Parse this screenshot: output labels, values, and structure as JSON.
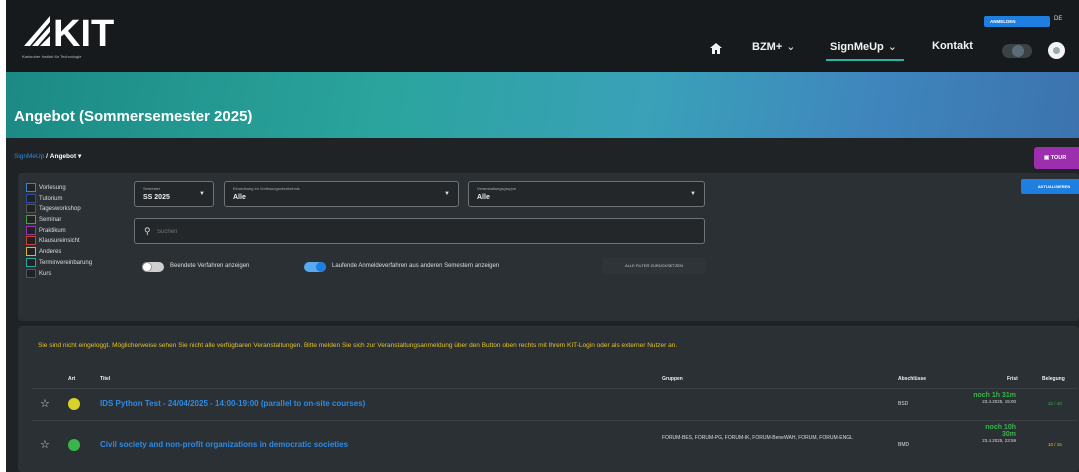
{
  "header": {
    "logo_text": "KIT",
    "logo_subtitle": "Karlsruher Institut für Technologie",
    "nav": {
      "home_icon": "home-icon",
      "bzm_label": "BZM+",
      "signmeup_label": "SignMeUp",
      "kontakt_label": "Kontakt"
    },
    "login_label": "ANMELDEN",
    "lang_label": "DE",
    "accent_color": "#2ab5a3"
  },
  "banner": {
    "title": "Angebot (Sommersemester 2025)"
  },
  "breadcrumb": {
    "root": "SignMeUp",
    "separator": "/",
    "current": "Angebot"
  },
  "tour_button": "TOUR",
  "filters": {
    "types": [
      {
        "label": "Vorlesung",
        "color": "#3a7fd0"
      },
      {
        "label": "Tutorium",
        "color": "#2c4e9c"
      },
      {
        "label": "Tagesworkshop",
        "color": "#555555"
      },
      {
        "label": "Seminar",
        "color": "#39a64a"
      },
      {
        "label": "Praktikum",
        "color": "#8c3aa8"
      },
      {
        "label": "Klausureinsicht",
        "color": "#c2462e"
      },
      {
        "label": "Anderes",
        "color": "#d8b82a"
      },
      {
        "label": "Terminvereinbarung",
        "color": "#2aa49d"
      },
      {
        "label": "Kurs",
        "color": "#4a5666"
      }
    ],
    "semester": {
      "label": "Semester",
      "value": "SS 2025"
    },
    "zuordnung": {
      "label": "Einordnung im Vorlesungsverzeichnis",
      "value": "Alle"
    },
    "gruppe": {
      "label": "Veranstaltungsgruppe",
      "value": "Alle"
    },
    "search_placeholder": "Suchen",
    "switch_finished": {
      "label": "Beendete Verfahren anzeigen",
      "on": false
    },
    "switch_running": {
      "label": "Laufende Anmeldeverfahren aus anderen Semestern anzeigen",
      "on": true
    },
    "reset_label": "ALLE FILTER ZURÜCKSETZEN",
    "update_label": "AKTUALISIEREN"
  },
  "results": {
    "notice": "Sie sind nicht eingeloggt. Möglicherweise sehen Sie nicht alle verfügbaren Veranstaltungen. Bitte melden Sie sich zur Veranstaltungsanmeldung über den Button oben rechts mit Ihrem KIT-Login oder als externer Nutzer an.",
    "columns": {
      "art": "Art",
      "titel": "Titel",
      "gruppen": "Gruppen",
      "abschluss": "Abschlüsse",
      "frist": "Frist",
      "belegung": "Belegung"
    },
    "rows": [
      {
        "dot_color": "#d8d22a",
        "title": "IDS Python Test - 24/04/2025 - 14:00-19:00 (parallel to on-site courses)",
        "groups": "",
        "abschluss": "BSD",
        "frist_line1": "noch 1h 31m",
        "frist_line2": "",
        "frist_date": "23.4.2025, 15:00",
        "belegung": "32 / 40",
        "belegung_color": "#39b54a"
      },
      {
        "dot_color": "#39b54a",
        "title": "Civil society and non-profit organizations in democratic societies",
        "groups": "FORUM-BES, FORUM-PG, FORUM-IK, FORUM-BeneWAH, FORUM, FORUM-ENGL",
        "abschluss": "BMD",
        "frist_line1": "noch 10h",
        "frist_line2": "30m",
        "frist_date": "23.4.2025, 23:59",
        "belegung": "10 / 15",
        "belegung_color": "#e2c12a"
      }
    ]
  }
}
